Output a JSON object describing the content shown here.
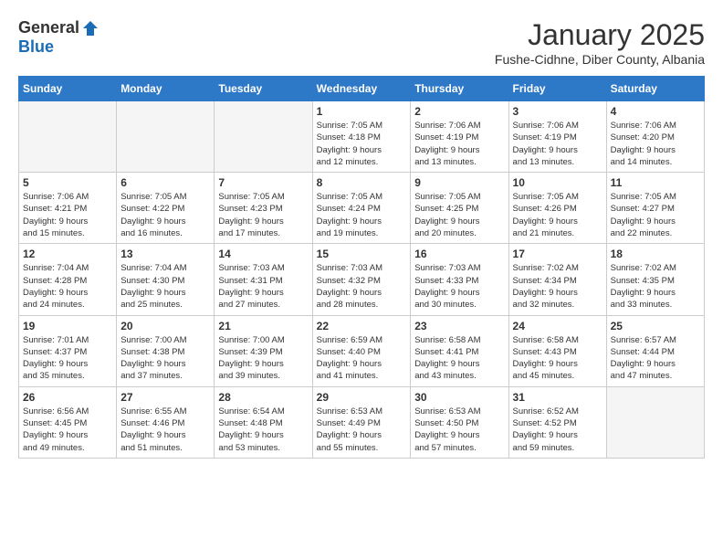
{
  "logo": {
    "general": "General",
    "blue": "Blue"
  },
  "title": "January 2025",
  "subtitle": "Fushe-Cidhne, Diber County, Albania",
  "weekdays": [
    "Sunday",
    "Monday",
    "Tuesday",
    "Wednesday",
    "Thursday",
    "Friday",
    "Saturday"
  ],
  "weeks": [
    [
      {
        "day": "",
        "info": ""
      },
      {
        "day": "",
        "info": ""
      },
      {
        "day": "",
        "info": ""
      },
      {
        "day": "1",
        "info": "Sunrise: 7:05 AM\nSunset: 4:18 PM\nDaylight: 9 hours\nand 12 minutes."
      },
      {
        "day": "2",
        "info": "Sunrise: 7:06 AM\nSunset: 4:19 PM\nDaylight: 9 hours\nand 13 minutes."
      },
      {
        "day": "3",
        "info": "Sunrise: 7:06 AM\nSunset: 4:19 PM\nDaylight: 9 hours\nand 13 minutes."
      },
      {
        "day": "4",
        "info": "Sunrise: 7:06 AM\nSunset: 4:20 PM\nDaylight: 9 hours\nand 14 minutes."
      }
    ],
    [
      {
        "day": "5",
        "info": "Sunrise: 7:06 AM\nSunset: 4:21 PM\nDaylight: 9 hours\nand 15 minutes."
      },
      {
        "day": "6",
        "info": "Sunrise: 7:05 AM\nSunset: 4:22 PM\nDaylight: 9 hours\nand 16 minutes."
      },
      {
        "day": "7",
        "info": "Sunrise: 7:05 AM\nSunset: 4:23 PM\nDaylight: 9 hours\nand 17 minutes."
      },
      {
        "day": "8",
        "info": "Sunrise: 7:05 AM\nSunset: 4:24 PM\nDaylight: 9 hours\nand 19 minutes."
      },
      {
        "day": "9",
        "info": "Sunrise: 7:05 AM\nSunset: 4:25 PM\nDaylight: 9 hours\nand 20 minutes."
      },
      {
        "day": "10",
        "info": "Sunrise: 7:05 AM\nSunset: 4:26 PM\nDaylight: 9 hours\nand 21 minutes."
      },
      {
        "day": "11",
        "info": "Sunrise: 7:05 AM\nSunset: 4:27 PM\nDaylight: 9 hours\nand 22 minutes."
      }
    ],
    [
      {
        "day": "12",
        "info": "Sunrise: 7:04 AM\nSunset: 4:28 PM\nDaylight: 9 hours\nand 24 minutes."
      },
      {
        "day": "13",
        "info": "Sunrise: 7:04 AM\nSunset: 4:30 PM\nDaylight: 9 hours\nand 25 minutes."
      },
      {
        "day": "14",
        "info": "Sunrise: 7:03 AM\nSunset: 4:31 PM\nDaylight: 9 hours\nand 27 minutes."
      },
      {
        "day": "15",
        "info": "Sunrise: 7:03 AM\nSunset: 4:32 PM\nDaylight: 9 hours\nand 28 minutes."
      },
      {
        "day": "16",
        "info": "Sunrise: 7:03 AM\nSunset: 4:33 PM\nDaylight: 9 hours\nand 30 minutes."
      },
      {
        "day": "17",
        "info": "Sunrise: 7:02 AM\nSunset: 4:34 PM\nDaylight: 9 hours\nand 32 minutes."
      },
      {
        "day": "18",
        "info": "Sunrise: 7:02 AM\nSunset: 4:35 PM\nDaylight: 9 hours\nand 33 minutes."
      }
    ],
    [
      {
        "day": "19",
        "info": "Sunrise: 7:01 AM\nSunset: 4:37 PM\nDaylight: 9 hours\nand 35 minutes."
      },
      {
        "day": "20",
        "info": "Sunrise: 7:00 AM\nSunset: 4:38 PM\nDaylight: 9 hours\nand 37 minutes."
      },
      {
        "day": "21",
        "info": "Sunrise: 7:00 AM\nSunset: 4:39 PM\nDaylight: 9 hours\nand 39 minutes."
      },
      {
        "day": "22",
        "info": "Sunrise: 6:59 AM\nSunset: 4:40 PM\nDaylight: 9 hours\nand 41 minutes."
      },
      {
        "day": "23",
        "info": "Sunrise: 6:58 AM\nSunset: 4:41 PM\nDaylight: 9 hours\nand 43 minutes."
      },
      {
        "day": "24",
        "info": "Sunrise: 6:58 AM\nSunset: 4:43 PM\nDaylight: 9 hours\nand 45 minutes."
      },
      {
        "day": "25",
        "info": "Sunrise: 6:57 AM\nSunset: 4:44 PM\nDaylight: 9 hours\nand 47 minutes."
      }
    ],
    [
      {
        "day": "26",
        "info": "Sunrise: 6:56 AM\nSunset: 4:45 PM\nDaylight: 9 hours\nand 49 minutes."
      },
      {
        "day": "27",
        "info": "Sunrise: 6:55 AM\nSunset: 4:46 PM\nDaylight: 9 hours\nand 51 minutes."
      },
      {
        "day": "28",
        "info": "Sunrise: 6:54 AM\nSunset: 4:48 PM\nDaylight: 9 hours\nand 53 minutes."
      },
      {
        "day": "29",
        "info": "Sunrise: 6:53 AM\nSunset: 4:49 PM\nDaylight: 9 hours\nand 55 minutes."
      },
      {
        "day": "30",
        "info": "Sunrise: 6:53 AM\nSunset: 4:50 PM\nDaylight: 9 hours\nand 57 minutes."
      },
      {
        "day": "31",
        "info": "Sunrise: 6:52 AM\nSunset: 4:52 PM\nDaylight: 9 hours\nand 59 minutes."
      },
      {
        "day": "",
        "info": ""
      }
    ]
  ]
}
